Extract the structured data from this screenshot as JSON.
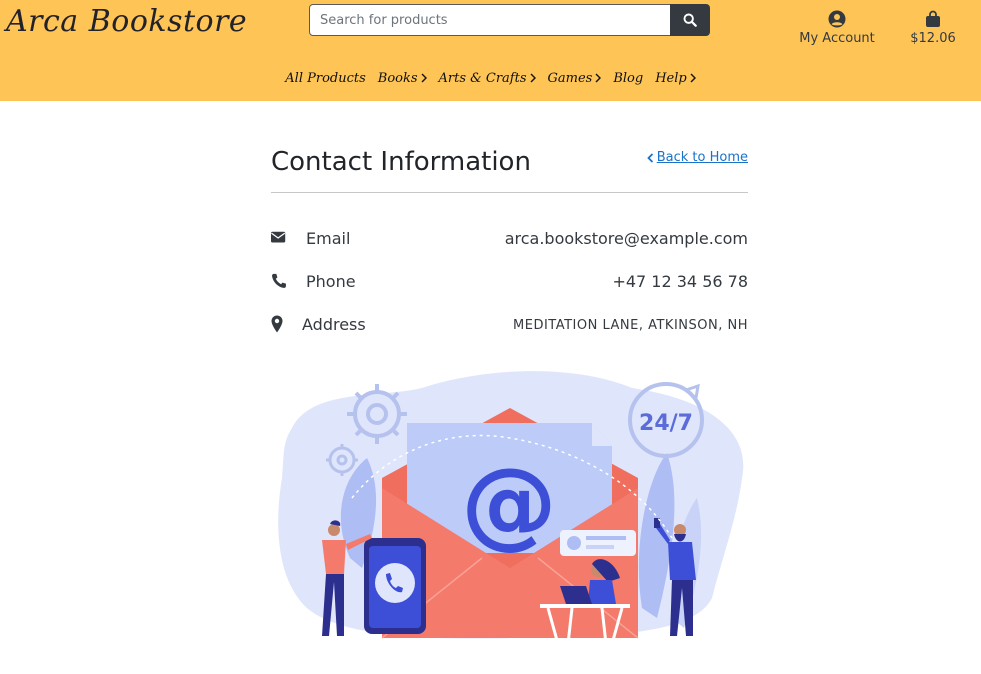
{
  "header": {
    "logo": "Arca Bookstore",
    "search": {
      "placeholder": "Search for products",
      "value": ""
    },
    "account_label": "My Account",
    "cart_total": "$12.06"
  },
  "nav": {
    "items": [
      {
        "label": "All Products",
        "has_chevron": false
      },
      {
        "label": "Books",
        "has_chevron": true
      },
      {
        "label": "Arts & Crafts",
        "has_chevron": true
      },
      {
        "label": "Games",
        "has_chevron": true
      },
      {
        "label": "Blog",
        "has_chevron": false
      },
      {
        "label": "Help",
        "has_chevron": true
      }
    ]
  },
  "main": {
    "title": "Contact Information",
    "back_link": "Back to Home",
    "contacts": [
      {
        "icon": "envelope-icon",
        "label": "Email",
        "value": "arca.bookstore@example.com"
      },
      {
        "icon": "phone-icon",
        "label": "Phone",
        "value": "+47 12 34 56 78"
      },
      {
        "icon": "map-marker-icon",
        "label": "Address",
        "value": "MEDITATION LANE, ATKINSON, NH"
      }
    ],
    "illustration_text": {
      "hours": "24/7",
      "at_symbol": "@"
    }
  },
  "colors": {
    "header_bg": "#fec556",
    "dark": "#343a40",
    "link": "#1a73c9",
    "illustration_blue": "#3d4fd6",
    "illustration_coral": "#f47a6b",
    "illustration_light": "#dfe5fb"
  }
}
